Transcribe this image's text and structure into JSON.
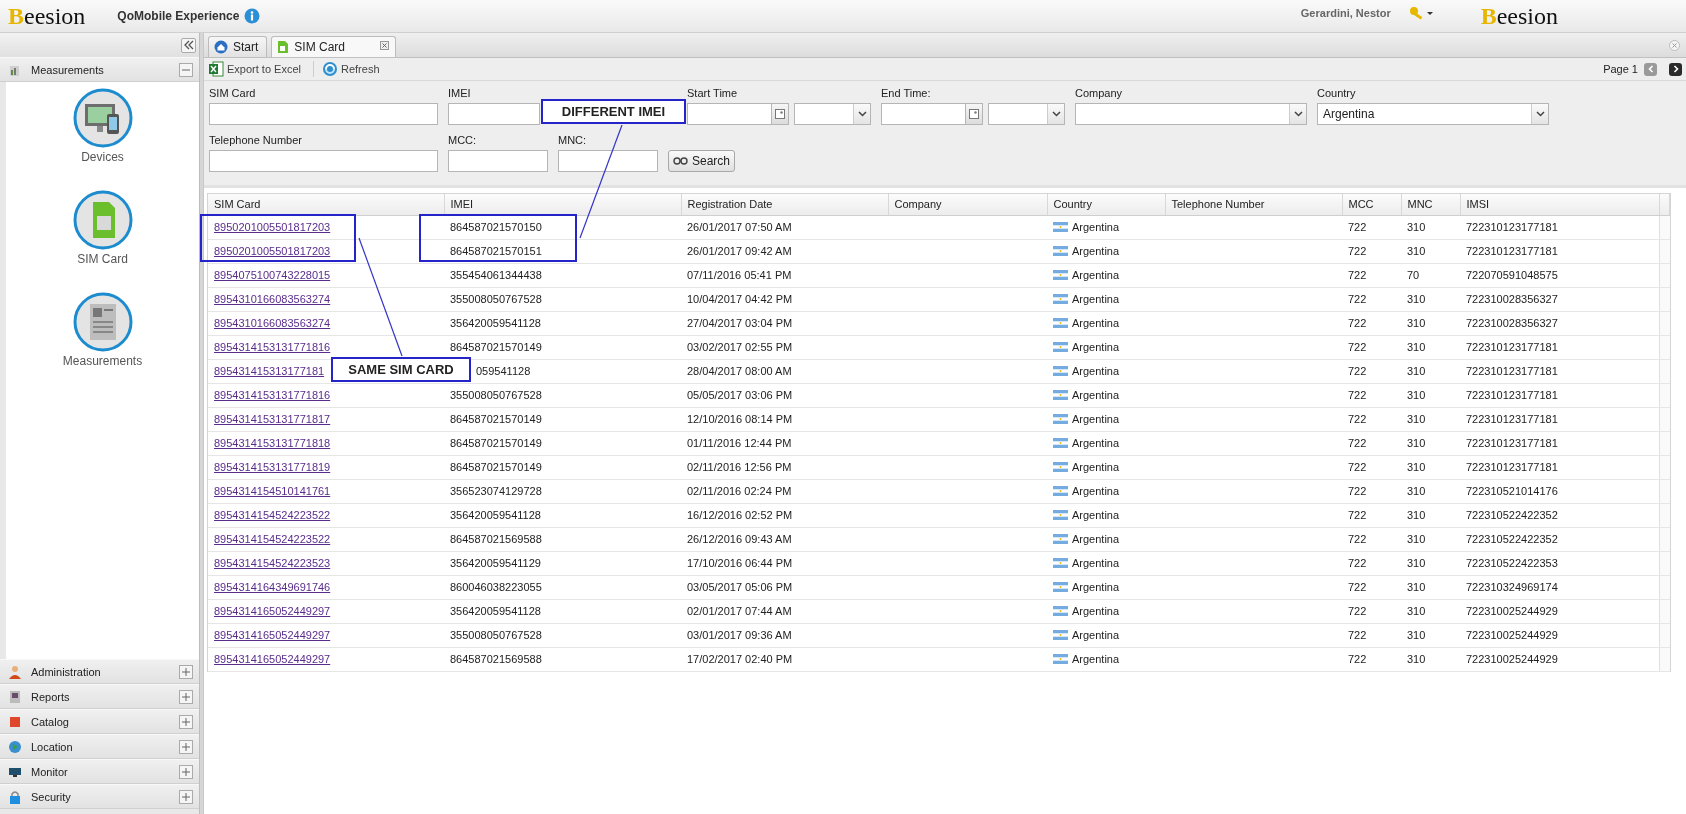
{
  "header": {
    "logo": "Beesion",
    "app_title": "QoMobile Experience",
    "user": "Gerardini, Nestor",
    "logo_right": "Beesion"
  },
  "sidebar": {
    "sections": [
      {
        "label": "Measurements",
        "expanded": true,
        "items": [
          {
            "label": "Devices"
          },
          {
            "label": "SIM Card"
          },
          {
            "label": "Measurements"
          }
        ]
      },
      {
        "label": "Administration",
        "expanded": false
      },
      {
        "label": "Reports",
        "expanded": false
      },
      {
        "label": "Catalog",
        "expanded": false
      },
      {
        "label": "Location",
        "expanded": false
      },
      {
        "label": "Monitor",
        "expanded": false
      },
      {
        "label": "Security",
        "expanded": false
      }
    ]
  },
  "tabs": [
    {
      "label": "Start",
      "selected": false
    },
    {
      "label": "SIM Card",
      "selected": true
    }
  ],
  "toolbar": {
    "buttons": [
      "Export to Excel",
      "Refresh"
    ],
    "page": "Page 1"
  },
  "filter_rows": [
    {
      "fields": [
        {
          "label": "SIM Card",
          "kind": "text"
        },
        {
          "label": "IMEI",
          "kind": "text"
        },
        {
          "label": "Start Time",
          "kind": "datetime"
        },
        {
          "label": "End Time:",
          "kind": "datetime"
        },
        {
          "label": "Company",
          "kind": "select"
        },
        {
          "label": "Country",
          "kind": "select",
          "value": "Argentina"
        }
      ]
    },
    {
      "fields": [
        {
          "label": "Telephone Number",
          "kind": "text"
        },
        {
          "label": "MCC:",
          "kind": "text"
        },
        {
          "label": "MNC:",
          "kind": "text"
        }
      ]
    }
  ],
  "search_button": "Search",
  "table": {
    "columns": [
      "SIM Card",
      "IMEI",
      "Registration Date",
      "Company",
      "Country",
      "Telephone Number",
      "MCC",
      "MNC",
      "IMSI"
    ],
    "rows": [
      {
        "sim_card": "8950201005501817203",
        "imei": "864587021570150",
        "registration_date": "26/01/2017 07:50 AM",
        "country": "Argentina",
        "mcc": "722",
        "mnc": "310",
        "imsi": "722310123177181",
        "covered": false
      },
      {
        "sim_card": "8950201005501817203",
        "imei": "864587021570151",
        "registration_date": "26/01/2017 09:42 AM",
        "country": "Argentina",
        "mcc": "722",
        "mnc": "310",
        "imsi": "722310123177181",
        "covered": false
      },
      {
        "sim_card": "8954075100743228015",
        "imei": "355454061344438",
        "registration_date": "07/11/2016 05:41 PM",
        "country": "Argentina",
        "mcc": "722",
        "mnc": "70",
        "imsi": "722070591048575",
        "covered": false
      },
      {
        "sim_card": "8954310166083563274",
        "imei": "355008050767528",
        "registration_date": "10/04/2017 04:42 PM",
        "country": "Argentina",
        "mcc": "722",
        "mnc": "310",
        "imsi": "722310028356327",
        "covered": false
      },
      {
        "sim_card": "8954310166083563274",
        "imei": "356420059541128",
        "registration_date": "27/04/2017 03:04 PM",
        "country": "Argentina",
        "mcc": "722",
        "mnc": "310",
        "imsi": "722310028356327",
        "covered": false
      },
      {
        "sim_card": "8954314153131771816",
        "imei": "864587021570149",
        "registration_date": "03/02/2017 02:55 PM",
        "country": "Argentina",
        "mcc": "722",
        "mnc": "310",
        "imsi": "722310123177181",
        "covered": false
      },
      {
        "sim_card": "895431415313177181",
        "imei": "059541128",
        "registration_date": "28/04/2017 08:00 AM",
        "country": "Argentina",
        "mcc": "722",
        "mnc": "310",
        "imsi": "722310123177181",
        "covered": true
      },
      {
        "sim_card": "8954314153131771816",
        "imei": "355008050767528",
        "registration_date": "05/05/2017 03:06 PM",
        "country": "Argentina",
        "mcc": "722",
        "mnc": "310",
        "imsi": "722310123177181",
        "covered": false
      },
      {
        "sim_card": "8954314153131771817",
        "imei": "864587021570149",
        "registration_date": "12/10/2016 08:14 PM",
        "country": "Argentina",
        "mcc": "722",
        "mnc": "310",
        "imsi": "722310123177181",
        "covered": false
      },
      {
        "sim_card": "8954314153131771818",
        "imei": "864587021570149",
        "registration_date": "01/11/2016 12:44 PM",
        "country": "Argentina",
        "mcc": "722",
        "mnc": "310",
        "imsi": "722310123177181",
        "covered": false
      },
      {
        "sim_card": "8954314153131771819",
        "imei": "864587021570149",
        "registration_date": "02/11/2016 12:56 PM",
        "country": "Argentina",
        "mcc": "722",
        "mnc": "310",
        "imsi": "722310123177181",
        "covered": false
      },
      {
        "sim_card": "8954314154510141761",
        "imei": "356523074129728",
        "registration_date": "02/11/2016 02:24 PM",
        "country": "Argentina",
        "mcc": "722",
        "mnc": "310",
        "imsi": "722310521014176",
        "covered": false
      },
      {
        "sim_card": "8954314154524223522",
        "imei": "356420059541128",
        "registration_date": "16/12/2016 02:52 PM",
        "country": "Argentina",
        "mcc": "722",
        "mnc": "310",
        "imsi": "722310522422352",
        "covered": false
      },
      {
        "sim_card": "8954314154524223522",
        "imei": "864587021569588",
        "registration_date": "26/12/2016 09:43 AM",
        "country": "Argentina",
        "mcc": "722",
        "mnc": "310",
        "imsi": "722310522422352",
        "covered": false
      },
      {
        "sim_card": "8954314154524223523",
        "imei": "356420059541129",
        "registration_date": "17/10/2016 06:44 PM",
        "country": "Argentina",
        "mcc": "722",
        "mnc": "310",
        "imsi": "722310522422353",
        "covered": false
      },
      {
        "sim_card": "8954314164349691746",
        "imei": "860046038223055",
        "registration_date": "03/05/2017 05:06 PM",
        "country": "Argentina",
        "mcc": "722",
        "mnc": "310",
        "imsi": "722310324969174",
        "covered": false
      },
      {
        "sim_card": "8954314165052449297",
        "imei": "356420059541128",
        "registration_date": "02/01/2017 07:44 AM",
        "country": "Argentina",
        "mcc": "722",
        "mnc": "310",
        "imsi": "722310025244929",
        "covered": false
      },
      {
        "sim_card": "8954314165052449297",
        "imei": "355008050767528",
        "registration_date": "03/01/2017 09:36 AM",
        "country": "Argentina",
        "mcc": "722",
        "mnc": "310",
        "imsi": "722310025244929",
        "covered": false
      },
      {
        "sim_card": "8954314165052449297",
        "imei": "864587021569588",
        "registration_date": "17/02/2017 02:40 PM",
        "country": "Argentina",
        "mcc": "722",
        "mnc": "310",
        "imsi": "722310025244929",
        "covered": false
      }
    ]
  },
  "annotations": [
    {
      "text": "DIFFERENT IMEI"
    },
    {
      "text": "SAME SIM CARD"
    }
  ]
}
